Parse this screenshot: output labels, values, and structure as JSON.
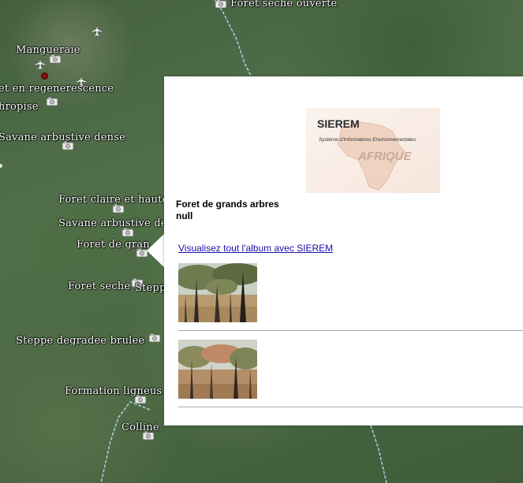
{
  "map": {
    "places": [
      {
        "name": "Foret seche ouverte",
        "camera": false
      },
      {
        "name": "Mangueraie",
        "camera": true
      },
      {
        "name": "et en regenerescence",
        "camera": false
      },
      {
        "name": "hropise",
        "camera": true
      },
      {
        "name": "Savane arbustive dense",
        "camera": true
      },
      {
        "name": "Foret claire et haute",
        "camera": true
      },
      {
        "name": "Savane arbustive de",
        "camera": true
      },
      {
        "name": "Foret de gran",
        "camera": true
      },
      {
        "name": "Foret seche",
        "camera": true
      },
      {
        "name": "Stepp",
        "camera": false
      },
      {
        "name": "Steppe degradee brulee",
        "camera": true
      },
      {
        "name": "Formation ligneus",
        "camera": true
      },
      {
        "name": "Colline",
        "camera": true
      }
    ]
  },
  "balloon": {
    "logo": {
      "brand": "SIEREM",
      "tagline": "Système d'Informations Environnementales",
      "region": "AFRIQUE"
    },
    "title": "Foret de grands arbres",
    "subtitle": "null",
    "album_link": "Visualisez tout l'album avec SIEREM",
    "photo_count": 2
  },
  "colors": {
    "link": "#1a0dab",
    "map_green": "#4a6843",
    "border_line": "#a9d3e8",
    "marker_red": "#8a1010"
  }
}
